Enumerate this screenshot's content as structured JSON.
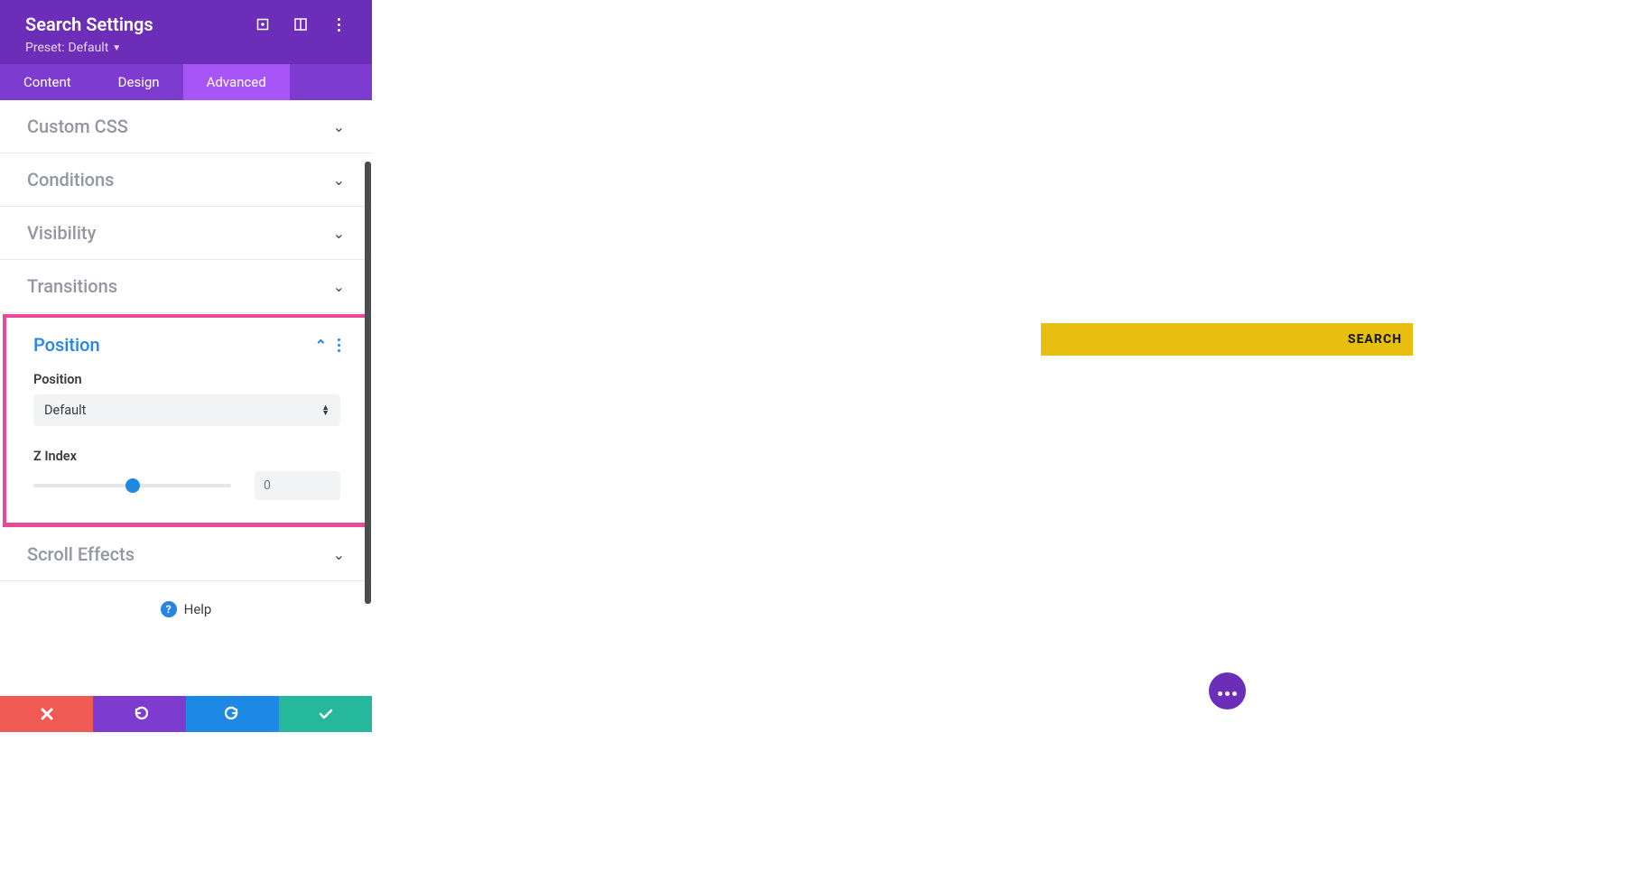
{
  "header": {
    "title": "Search Settings",
    "preset_label": "Preset:",
    "preset_value": "Default"
  },
  "tabs": {
    "content": "Content",
    "design": "Design",
    "advanced": "Advanced",
    "active": "Advanced"
  },
  "sections": {
    "custom_css": "Custom CSS",
    "conditions": "Conditions",
    "visibility": "Visibility",
    "transitions": "Transitions",
    "position": "Position",
    "scroll_effects": "Scroll Effects"
  },
  "position_panel": {
    "field1_label": "Position",
    "field1_value": "Default",
    "field2_label": "Z Index",
    "zindex_placeholder": "0",
    "slider_percent": 50
  },
  "help_label": "Help",
  "canvas": {
    "search_button_label": "SEARCH"
  },
  "colors": {
    "highlight": "#ec4899",
    "primary_purple": "#6c2eb9",
    "active_tab": "#a855f7",
    "search_bar": "#e8bf0f"
  }
}
